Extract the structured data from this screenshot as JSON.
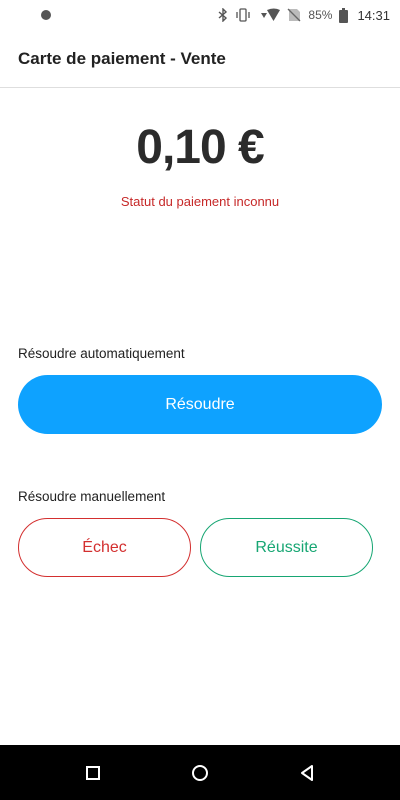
{
  "status_bar": {
    "battery": "85%",
    "time": "14:31",
    "icons": [
      "notification-dot-icon",
      "bluetooth-icon",
      "vibrate-icon",
      "wifi-icon",
      "no-sim-icon",
      "battery-icon"
    ]
  },
  "header": {
    "title": "Carte de paiement - Vente"
  },
  "payment": {
    "amount": "0,10 €",
    "status": "Statut du paiement inconnu"
  },
  "auto_section": {
    "label": "Résoudre automatiquement",
    "button": "Résoudre"
  },
  "manual_section": {
    "label": "Résoudre manuellement",
    "fail_button": "Échec",
    "success_button": "Réussite"
  },
  "colors": {
    "primary": "#0ea2ff",
    "error": "#d32f2f",
    "success": "#17a673"
  },
  "nav_bar": {
    "icons": [
      "recents-square-icon",
      "home-circle-icon",
      "back-triangle-icon"
    ]
  }
}
